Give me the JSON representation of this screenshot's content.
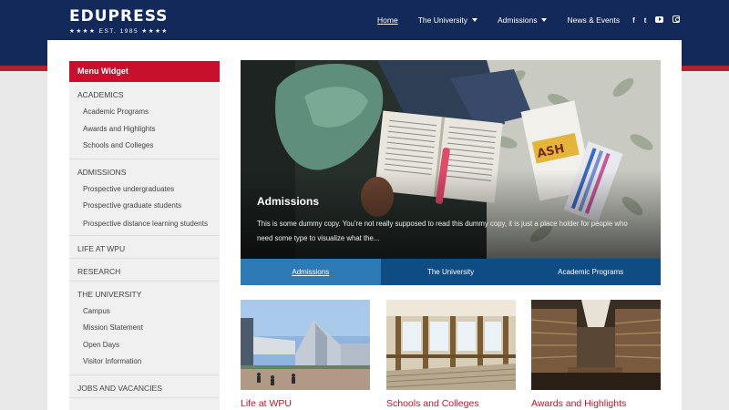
{
  "brand": {
    "name": "EDUPRESS",
    "tagline": "★★★★ EST. 1985 ★★★★"
  },
  "nav": {
    "items": [
      {
        "label": "Home",
        "active": true,
        "has_dropdown": false
      },
      {
        "label": "The University",
        "active": false,
        "has_dropdown": true
      },
      {
        "label": "Admissions",
        "active": false,
        "has_dropdown": true
      },
      {
        "label": "News & Events",
        "active": false,
        "has_dropdown": false
      }
    ],
    "social": [
      {
        "icon": "facebook-icon",
        "glyph": "f"
      },
      {
        "icon": "twitter-icon",
        "glyph": "t"
      },
      {
        "icon": "youtube-icon"
      },
      {
        "icon": "instagram-icon"
      }
    ]
  },
  "sidebar": {
    "title": "Menu Widget",
    "sections": [
      {
        "label": "ACADEMICS",
        "items": [
          "Academic Programs",
          "Awards and Highlights",
          "Schools and Colleges"
        ]
      },
      {
        "label": "ADMISSIONS",
        "items": [
          "Prospective undergraduates",
          "Prospective graduate students",
          "Prospective distance learning students"
        ]
      },
      {
        "label": "LIFE AT WPU",
        "items": []
      },
      {
        "label": "RESEARCH",
        "items": []
      },
      {
        "label": "THE UNIVERSITY",
        "items": [
          "Campus",
          "Mission Statement",
          "Open Days",
          "Visitor Information"
        ]
      },
      {
        "label": "JOBS AND VACANCIES",
        "items": []
      }
    ]
  },
  "hero": {
    "title": "Admissions",
    "text": "This is some dummy copy. You’re not really supposed to read this dummy copy, it is just a place holder for people who need some type to visualize what the..."
  },
  "tabs": [
    {
      "label": "Admissions",
      "active": true
    },
    {
      "label": "The University",
      "active": false
    },
    {
      "label": "Academic Programs",
      "active": false
    }
  ],
  "cards": [
    {
      "title": "Life at WPU"
    },
    {
      "title": "Schools and Colleges"
    },
    {
      "title": "Awards and Highlights"
    }
  ],
  "colors": {
    "header": "#13295a",
    "accent_red": "#c8102e",
    "tab_bar": "#0f4c84",
    "tab_active": "#2c79b6"
  }
}
